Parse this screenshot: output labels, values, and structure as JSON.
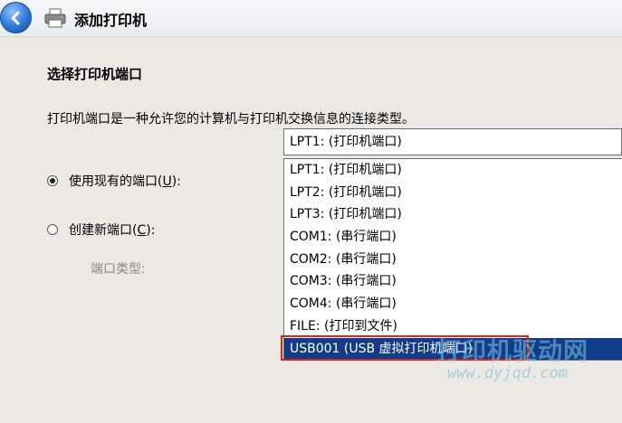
{
  "window": {
    "title": "添加打印机"
  },
  "main": {
    "heading": "选择打印机端口",
    "description": "打印机端口是一种允许您的计算机与打印机交换信息的连接类型。",
    "use_existing": {
      "label_before": "使用现有的端口(",
      "key": "U",
      "label_after": "):",
      "checked": true
    },
    "create_new": {
      "label_before": "创建新端口(",
      "key": "C",
      "label_after": "):",
      "checked": false
    },
    "port_type_label": "端口类型:"
  },
  "port_select": {
    "selected_value": "LPT1: (打印机端口)",
    "options": [
      "LPT1: (打印机端口)",
      "LPT2: (打印机端口)",
      "LPT3: (打印机端口)",
      "COM1: (串行端口)",
      "COM2: (串行端口)",
      "COM3: (串行端口)",
      "COM4: (串行端口)",
      "FILE: (打印到文件)",
      "USB001 (USB 虚拟打印机端口)"
    ],
    "highlighted_index": 8
  },
  "watermark": {
    "brand": "打印机驱动网",
    "url": "www.dyjqd.com"
  },
  "colors": {
    "selection": "#123c8a",
    "callout_border": "#e2231a"
  }
}
